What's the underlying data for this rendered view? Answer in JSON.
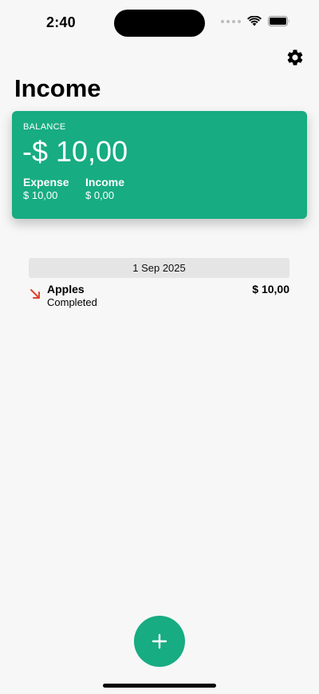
{
  "status_bar": {
    "time": "2:40",
    "icons": [
      "signal-icon",
      "wifi-icon",
      "battery-icon"
    ]
  },
  "header": {
    "title": "Income",
    "settings_icon": "gear-icon"
  },
  "balance_card": {
    "label": "BALANCE",
    "amount": "-$ 10,00",
    "expense_label": "Expense",
    "expense_value": "$ 10,00",
    "income_label": "Income",
    "income_value": "$ 0,00",
    "color": "#17ac82"
  },
  "transactions": {
    "groups": [
      {
        "date": "1 Sep 2025",
        "items": [
          {
            "name": "Apples",
            "status": "Completed",
            "amount": "$ 10,00",
            "direction_icon": "arrow-down-right-icon",
            "direction_color": "#e0452c"
          }
        ]
      }
    ]
  },
  "fab": {
    "icon": "plus-icon",
    "color": "#17ac82"
  }
}
